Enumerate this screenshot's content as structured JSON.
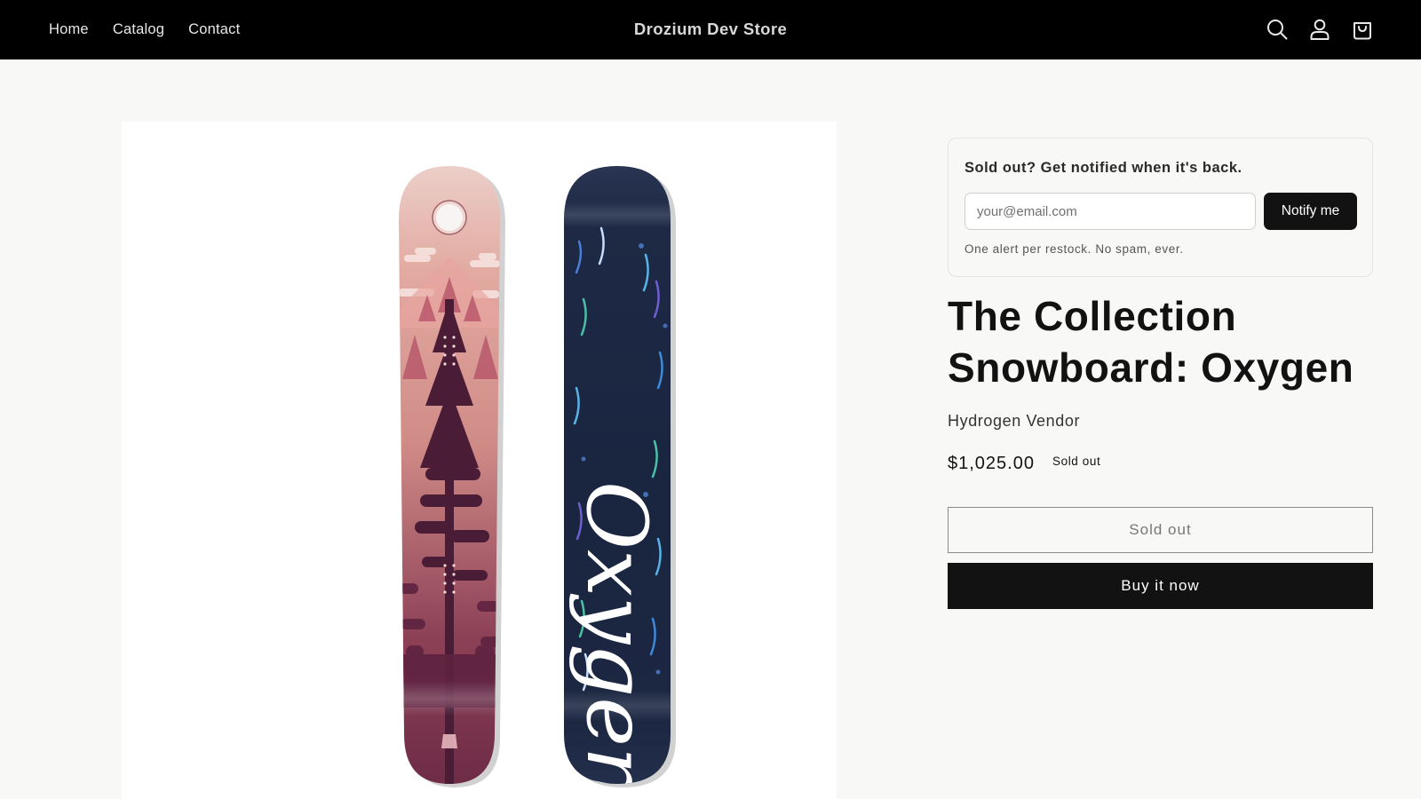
{
  "header": {
    "nav": [
      {
        "label": "Home"
      },
      {
        "label": "Catalog"
      },
      {
        "label": "Contact"
      }
    ],
    "store_name": "Drozium Dev Store",
    "icons": [
      "search-icon",
      "account-icon",
      "cart-icon"
    ]
  },
  "media": {
    "image_icon": "snowboard-product-image",
    "wordmark": "Oxygen",
    "colors": {
      "board_left_top": "#e9c7c1",
      "board_left_bottom": "#6d2d45",
      "board_right": "#1d2a44"
    }
  },
  "notify": {
    "title": "Sold out? Get notified when it's back.",
    "email_placeholder": "your@email.com",
    "button_label": "Notify me",
    "note": "One alert per restock. No spam, ever."
  },
  "product": {
    "title_line1": "The Collection",
    "title_line2": "Snowboard: Oxygen",
    "vendor": "Hydrogen Vendor",
    "price": "$1,025.00",
    "badge": "Sold out",
    "sold_out_button": "Sold out",
    "buy_now_button": "Buy it now"
  }
}
